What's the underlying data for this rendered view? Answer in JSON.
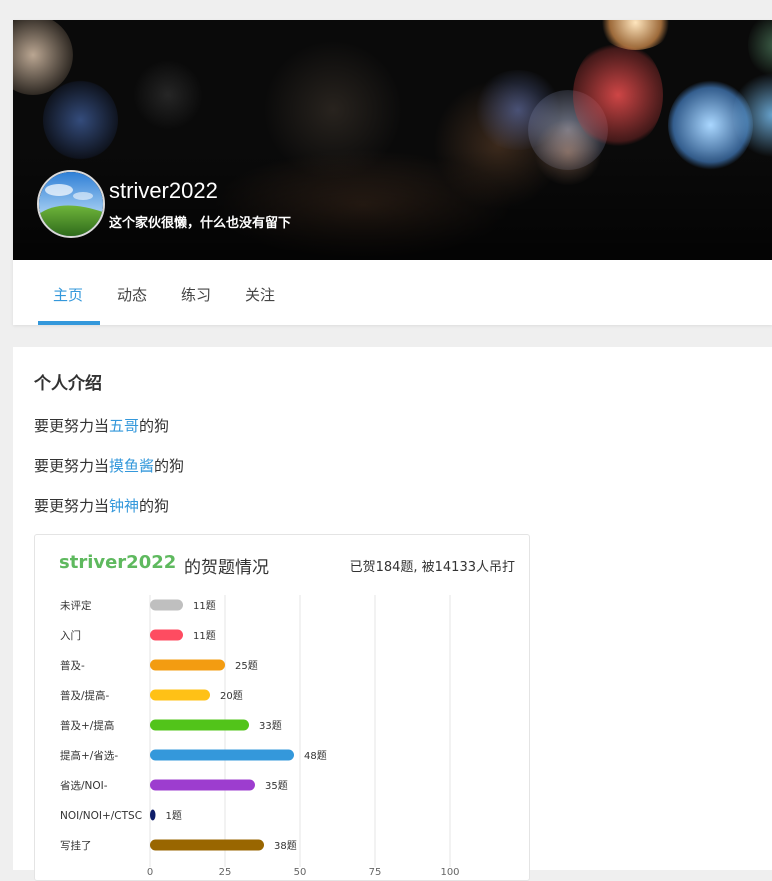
{
  "profile": {
    "username": "striver2022",
    "bio": "这个家伙很懒，什么也没有留下"
  },
  "tabs": [
    {
      "label": "主页",
      "active": true
    },
    {
      "label": "动态",
      "active": false
    },
    {
      "label": "练习",
      "active": false
    },
    {
      "label": "关注",
      "active": false
    }
  ],
  "intro": {
    "title": "个人介绍",
    "lines": [
      {
        "prefix": "要更努力当",
        "highlight": "五哥",
        "suffix": "的狗"
      },
      {
        "prefix": "要更努力当",
        "highlight": "摸鱼酱",
        "suffix": "的狗"
      },
      {
        "prefix": "要更努力当",
        "highlight": "钟神",
        "suffix": "的狗"
      }
    ]
  },
  "stats": {
    "username": "striver2022",
    "suffix": "的贺题情况",
    "summary": "已贺184题, 被14133人吊打"
  },
  "colors": {
    "accent": "#3498db",
    "username_green": "#5eb95e"
  },
  "chart_data": {
    "type": "bar",
    "orientation": "horizontal",
    "categories": [
      "未评定",
      "入门",
      "普及-",
      "普及/提高-",
      "普及+/提高",
      "提高+/省选-",
      "省选/NOI-",
      "NOI/NOI+/CTSC",
      "写挂了"
    ],
    "values": [
      11,
      11,
      25,
      20,
      33,
      48,
      35,
      1,
      38
    ],
    "value_labels": [
      "11题",
      "11题",
      "25题",
      "20题",
      "33题",
      "48题",
      "35题",
      "1题",
      "38题"
    ],
    "colors": [
      "#bfbfbf",
      "#fe4c61",
      "#f39c11",
      "#ffc116",
      "#52c41a",
      "#3498db",
      "#9d3dcf",
      "#0e1d69",
      "#996600"
    ],
    "x_ticks": [
      0,
      25,
      50,
      75,
      100
    ],
    "xlim": [
      0,
      100
    ],
    "grid": true
  }
}
